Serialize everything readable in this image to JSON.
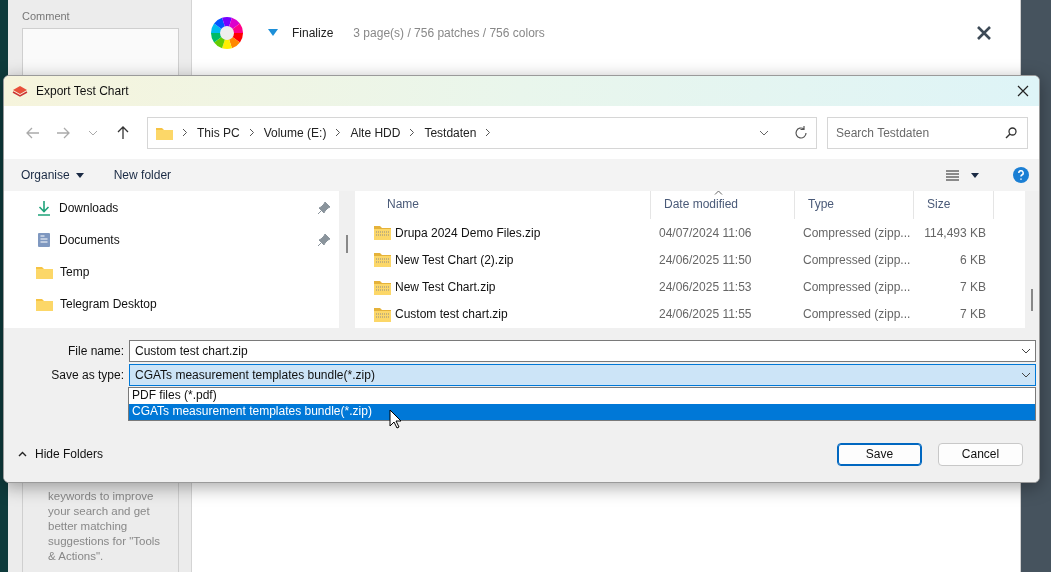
{
  "app": {
    "comment_label": "Comment",
    "toolbar": {
      "title": "Finalize",
      "summary": "3 page(s) / 756 patches / 756 colors"
    },
    "tip": "keywords to improve your search and get better matching suggestions for \"Tools & Actions\"."
  },
  "dialog": {
    "title": "Export Test Chart",
    "breadcrumb": [
      "This PC",
      "Volume (E:)",
      "Alte HDD",
      "Testdaten"
    ],
    "search": {
      "placeholder": "Search Testdaten"
    },
    "commands": [
      {
        "label": "Organise",
        "menu": true
      },
      {
        "label": "New folder",
        "menu": false
      }
    ],
    "nav": [
      {
        "label": "Downloads",
        "kind": "download",
        "pinned": true
      },
      {
        "label": "Documents",
        "kind": "document",
        "pinned": true
      },
      {
        "label": "Temp",
        "kind": "folder",
        "pinned": false
      },
      {
        "label": "Telegram Desktop",
        "kind": "folder",
        "pinned": false
      }
    ],
    "columns": [
      "Name",
      "Date modified",
      "Type",
      "Size"
    ],
    "files": [
      {
        "name": "Drupa 2024 Demo Files.zip",
        "date": "04/07/2024 11:06",
        "type": "Compressed (zipp...",
        "size": "114,493 KB"
      },
      {
        "name": "New Test Chart (2).zip",
        "date": "24/06/2025 11:50",
        "type": "Compressed (zipp...",
        "size": "6 KB"
      },
      {
        "name": "New Test Chart.zip",
        "date": "24/06/2025 11:53",
        "type": "Compressed (zipp...",
        "size": "7 KB"
      },
      {
        "name": "Custom test chart.zip",
        "date": "24/06/2025 11:55",
        "type": "Compressed (zipp...",
        "size": "7 KB"
      }
    ],
    "file_name": {
      "label": "File name:",
      "value": "Custom test chart.zip"
    },
    "save_type": {
      "label": "Save as type:",
      "value": "CGATs measurement templates bundle(*.zip)",
      "expanded": true,
      "options": [
        {
          "label": "PDF files (*.pdf)",
          "selected": false
        },
        {
          "label": "CGATs measurement templates bundle(*.zip)",
          "selected": true
        }
      ]
    },
    "hide_folders": "Hide Folders",
    "buttons": [
      {
        "label": "Save",
        "default": true
      },
      {
        "label": "Cancel",
        "default": false
      }
    ]
  }
}
